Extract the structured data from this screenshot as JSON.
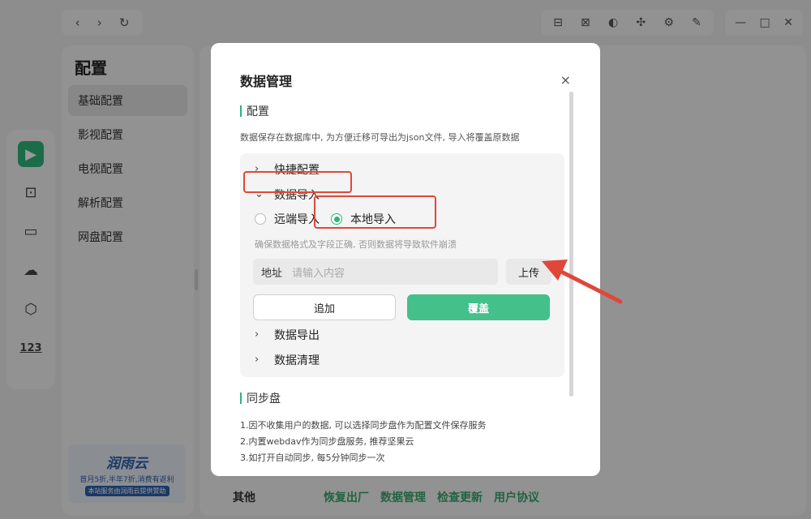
{
  "titlebar": {
    "back_icon": "‹",
    "forward_icon": "›",
    "refresh_icon": "↻",
    "tool_icons": [
      "toolbox-icon",
      "layout-icon",
      "theme-icon",
      "puzzle-icon",
      "gear-icon",
      "pin-icon"
    ],
    "tool_glyphs": [
      "⊟",
      "⊠",
      "◐",
      "✣",
      "⚙",
      "✎"
    ],
    "window_glyphs": [
      "—",
      "□",
      "✕"
    ]
  },
  "rail": {
    "logo": "▶",
    "icons": [
      "⊡",
      "▭",
      "☁",
      "⬡",
      "123"
    ]
  },
  "left_panel": {
    "title": "配置",
    "items": [
      "基础配置",
      "影视配置",
      "电视配置",
      "解析配置",
      "网盘配置"
    ],
    "active_index": 0
  },
  "ad": {
    "brand": "润雨云",
    "line": "首月5折,半年7折,消费有返利",
    "foot": "本站服务由润雨云提供赞助"
  },
  "bottom": {
    "label": "其他",
    "links": [
      "恢复出厂",
      "数据管理",
      "检查更新",
      "用户协议"
    ]
  },
  "modal": {
    "title": "数据管理",
    "close": "×",
    "config_section": "配置",
    "config_desc": "数据保存在数据库中, 为方便迁移可导出为json文件, 导入将覆盖原数据",
    "quick_config": "快捷配置",
    "data_import": "数据导入",
    "remote_import": "远端导入",
    "local_import": "本地导入",
    "selected": "local",
    "warning": "确保数据格式及字段正确, 否则数据将导致软件崩溃",
    "address_label": "地址",
    "address_placeholder": "请输入内容",
    "upload": "上传",
    "append": "追加",
    "overwrite": "覆盖",
    "data_export": "数据导出",
    "data_clear": "数据清理",
    "sync_section": "同步盘",
    "sync_lines": [
      "1.因不收集用户的数据, 可以选择同步盘作为配置文件保存服务",
      "2.内置webdav作为同步盘服务, 推荐坚果云",
      "3.如打开自动同步, 每5分钟同步一次"
    ]
  },
  "colors": {
    "accent": "#2fb37a",
    "button_green": "#44c08b",
    "annotation_red": "#e0473a"
  }
}
